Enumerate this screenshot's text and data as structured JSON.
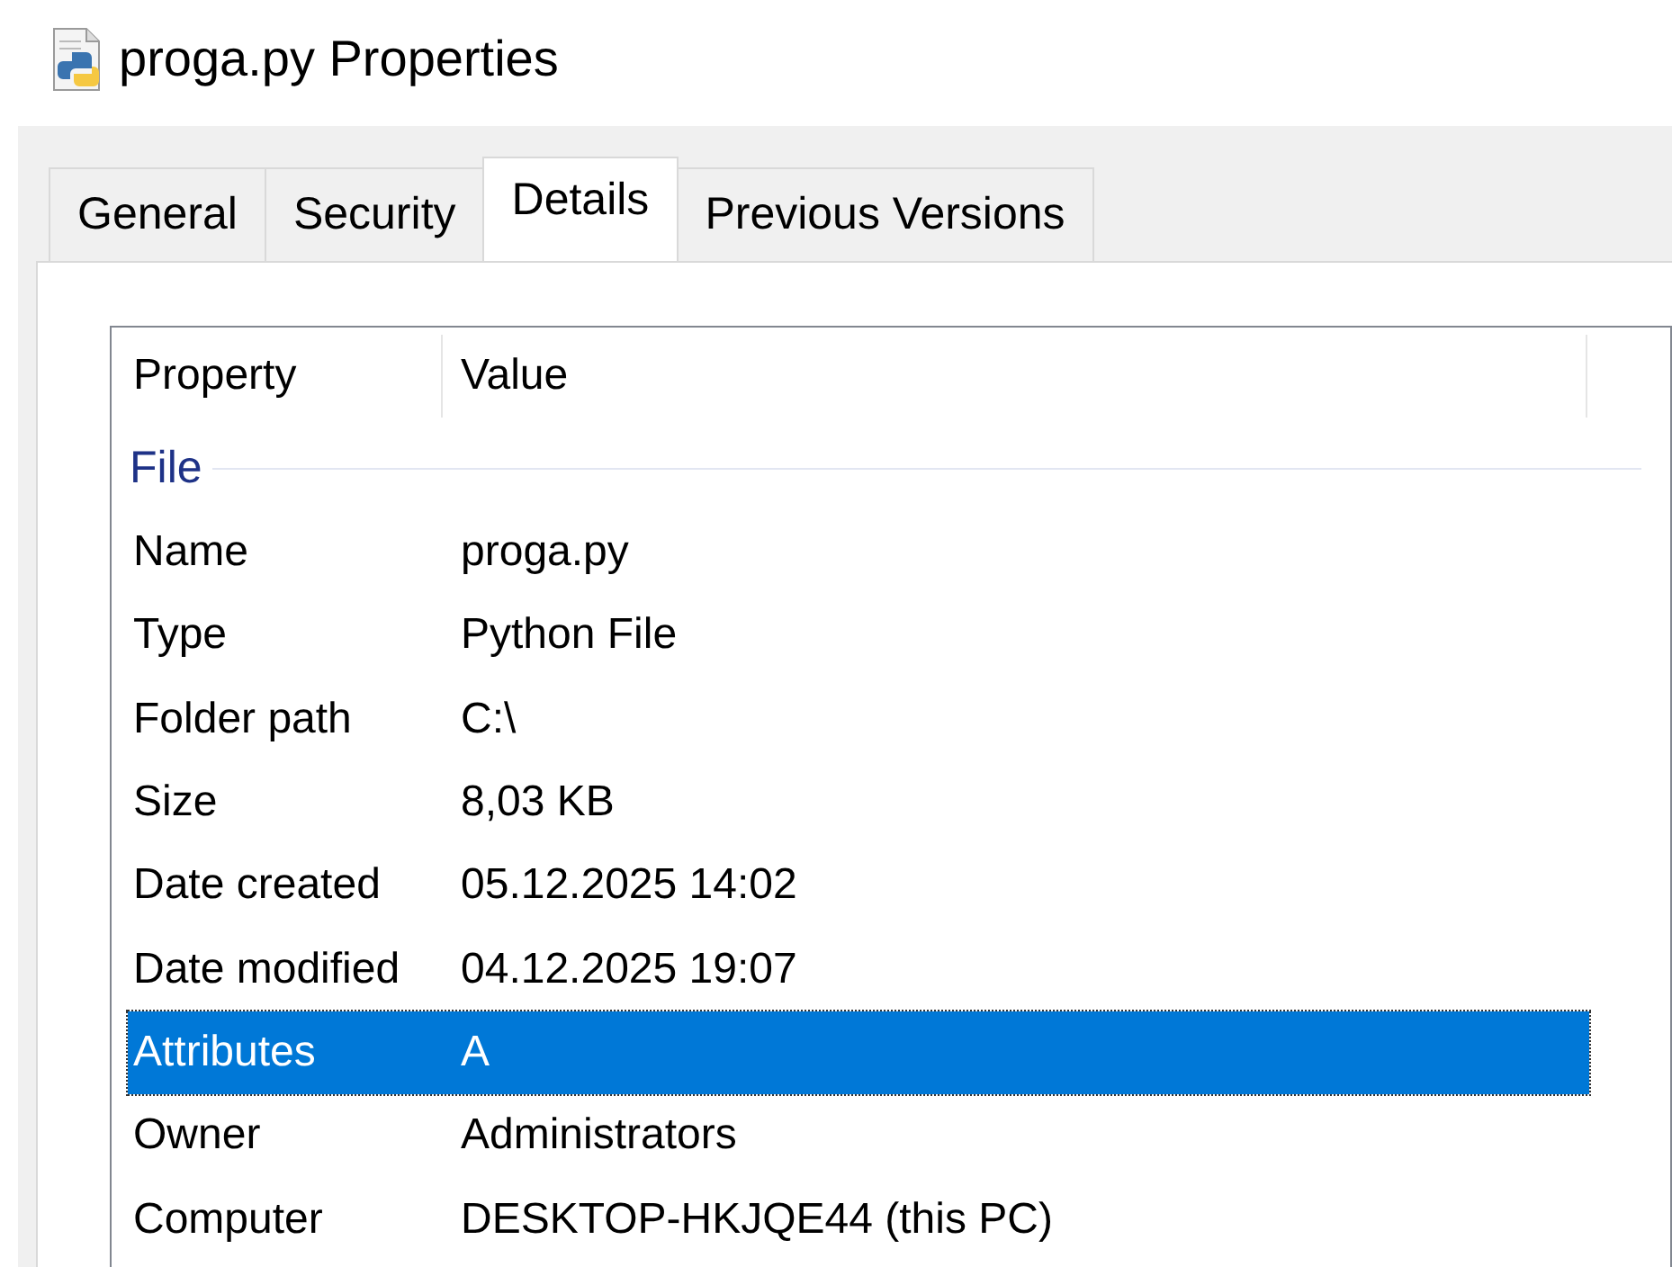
{
  "window": {
    "title": "proga.py Properties"
  },
  "tabs": [
    {
      "label": "General",
      "selected": false
    },
    {
      "label": "Security",
      "selected": false
    },
    {
      "label": "Details",
      "selected": true
    },
    {
      "label": "Previous Versions",
      "selected": false
    }
  ],
  "table": {
    "columns": [
      "Property",
      "Value"
    ],
    "group": "File",
    "rows": [
      {
        "property": "Name",
        "value": "proga.py",
        "selected": false
      },
      {
        "property": "Type",
        "value": "Python File",
        "selected": false
      },
      {
        "property": "Folder path",
        "value": "C:\\",
        "selected": false
      },
      {
        "property": "Size",
        "value": "8,03 KB",
        "selected": false
      },
      {
        "property": "Date created",
        "value": "05.12.2025 14:02",
        "selected": false
      },
      {
        "property": "Date modified",
        "value": "04.12.2025 19:07",
        "selected": false
      },
      {
        "property": "Attributes",
        "value": "A",
        "selected": true
      },
      {
        "property": "Owner",
        "value": "Administrators",
        "selected": false
      },
      {
        "property": "Computer",
        "value": "DESKTOP-HKJQE44 (this PC)",
        "selected": false
      }
    ]
  }
}
